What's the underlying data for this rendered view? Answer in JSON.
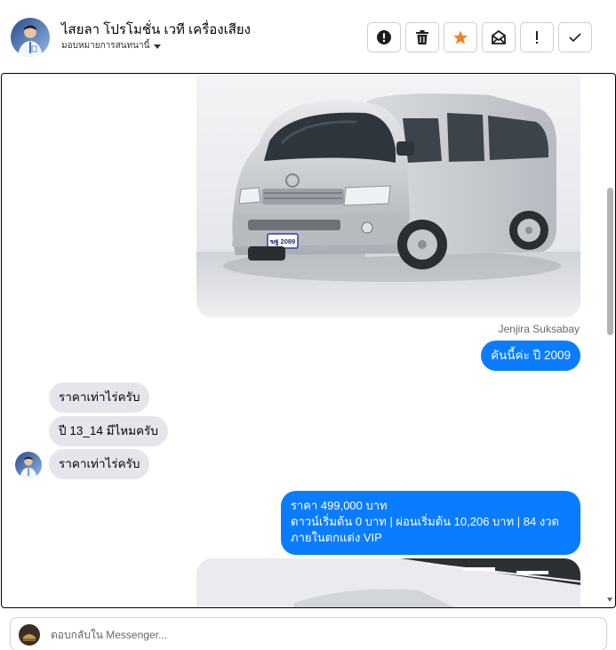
{
  "header": {
    "contact_name": "ไสยลา โปรโมชั่น เวที เครื่องเสียง",
    "assign_label": "มอบหมายการสนทนานี้"
  },
  "toolbar": {
    "buttons": [
      {
        "name": "spam-button",
        "icon": "alert-circle-icon"
      },
      {
        "name": "delete-button",
        "icon": "trash-icon"
      },
      {
        "name": "star-button",
        "icon": "star-icon",
        "color": "#f5821f"
      },
      {
        "name": "mark-unread-button",
        "icon": "envelope-icon"
      },
      {
        "name": "follow-up-button",
        "icon": "exclamation-icon"
      },
      {
        "name": "done-button",
        "icon": "check-icon"
      }
    ]
  },
  "conversation": {
    "sender_name": "Jenjira Suksabay",
    "messages": [
      {
        "direction": "out",
        "text": "คันนี้ค่ะ ปี 2009"
      },
      {
        "direction": "in",
        "text": "ราคาเท่าไร่ครับ"
      },
      {
        "direction": "in",
        "text": "ปี 13_14 มีไหมครับ"
      },
      {
        "direction": "in",
        "text": "ราคาเท่าไร่ครับ"
      },
      {
        "direction": "out",
        "lines": [
          "ราคา 499,000 บาท",
          "ดาวน์เริ่มต้น 0 บาท | ผ่อนเริ่มต้น 10,206 บาท | 84 งวด",
          " ภายในตกแต่ง VIP"
        ]
      }
    ],
    "plate_text": "ฆฐ 2089"
  },
  "composer": {
    "placeholder": "ตอบกลับใน Messenger..."
  },
  "colors": {
    "outgoing_bubble": "#0a7cff",
    "incoming_bubble": "#e4e6eb",
    "star": "#f5821f"
  }
}
